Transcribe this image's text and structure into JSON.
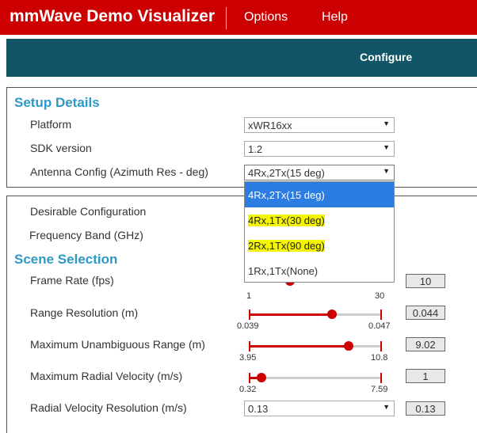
{
  "app": {
    "title": "mmWave Demo Visualizer",
    "menu": [
      "Options",
      "Help"
    ],
    "tab": "Configure"
  },
  "colors": {
    "header": "#cc0000",
    "tabbar": "#115566",
    "accent": "#2e99c6",
    "slider": "#cc0000"
  },
  "setup": {
    "title": "Setup Details",
    "platform_label": "Platform",
    "platform_value": "xWR16xx",
    "sdk_label": "SDK version",
    "sdk_value": "1.2",
    "antenna_label": "Antenna Config (Azimuth Res - deg)",
    "antenna_value": "4Rx,2Tx(15 deg)",
    "antenna_options": [
      "4Rx,2Tx(15 deg)",
      "4Rx,1Tx(30 deg)",
      "2Rx,1Tx(90 deg)",
      "1Rx,1Tx(None)"
    ]
  },
  "config": {
    "desirable_label": "Desirable Configuration",
    "freq_label": "Frequency Band (GHz)"
  },
  "scene": {
    "title": "Scene Selection",
    "sliders": [
      {
        "label": "Frame Rate (fps)",
        "min": "1",
        "max": "30",
        "value": "10",
        "fraction": 0.31
      },
      {
        "label": "Range Resolution (m)",
        "min": "0.039",
        "max": "0.047",
        "value": "0.044",
        "fraction": 0.63
      },
      {
        "label": "Maximum Unambiguous Range (m)",
        "min": "3.95",
        "max": "10.8",
        "value": "9.02",
        "fraction": 0.74
      },
      {
        "label": "Maximum Radial Velocity (m/s)",
        "min": "0.32",
        "max": "7.59",
        "value": "1",
        "fraction": 0.09
      }
    ],
    "radial_res_label": "Radial Velocity Resolution (m/s)",
    "radial_res_select": "0.13",
    "radial_res_value": "0.13"
  }
}
